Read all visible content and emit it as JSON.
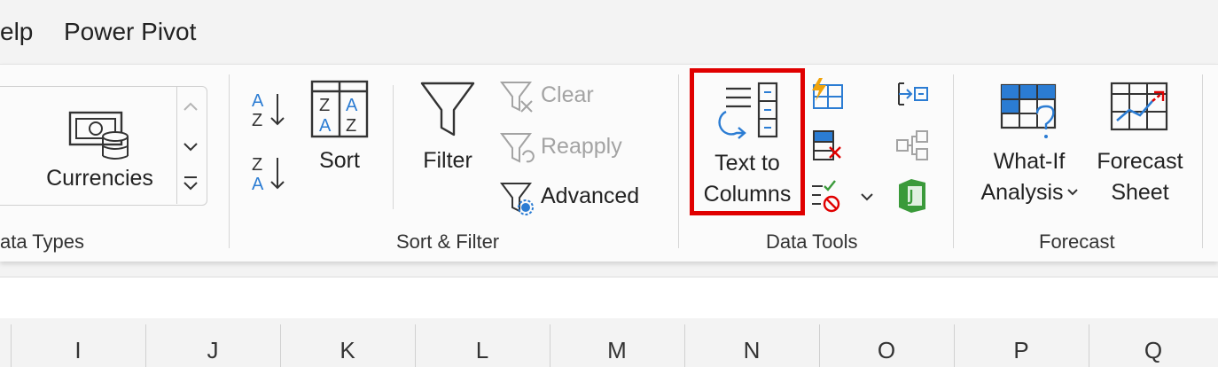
{
  "tabs": [
    {
      "label": "elp"
    },
    {
      "label": "Power Pivot"
    }
  ],
  "data_types": {
    "currencies_label": "Currencies",
    "group_label": "ata Types"
  },
  "sort_filter": {
    "sort_label": "Sort",
    "filter_label": "Filter",
    "clear_label": "Clear",
    "reapply_label": "Reapply",
    "advanced_label": "Advanced",
    "group_label": "Sort & Filter"
  },
  "data_tools": {
    "text_to_columns_line1": "Text to",
    "text_to_columns_line2": "Columns",
    "group_label": "Data Tools"
  },
  "forecast": {
    "what_if_line1": "What-If",
    "what_if_line2": "Analysis",
    "forecast_sheet_line1": "Forecast",
    "forecast_sheet_line2": "Sheet",
    "group_label": "Forecast"
  },
  "columns": [
    "I",
    "J",
    "K",
    "L",
    "M",
    "N",
    "O",
    "P",
    "Q"
  ],
  "colors": {
    "highlight": "#e00000",
    "accent_blue": "#2b7cd3",
    "disabled_gray": "#a3a3a3"
  }
}
